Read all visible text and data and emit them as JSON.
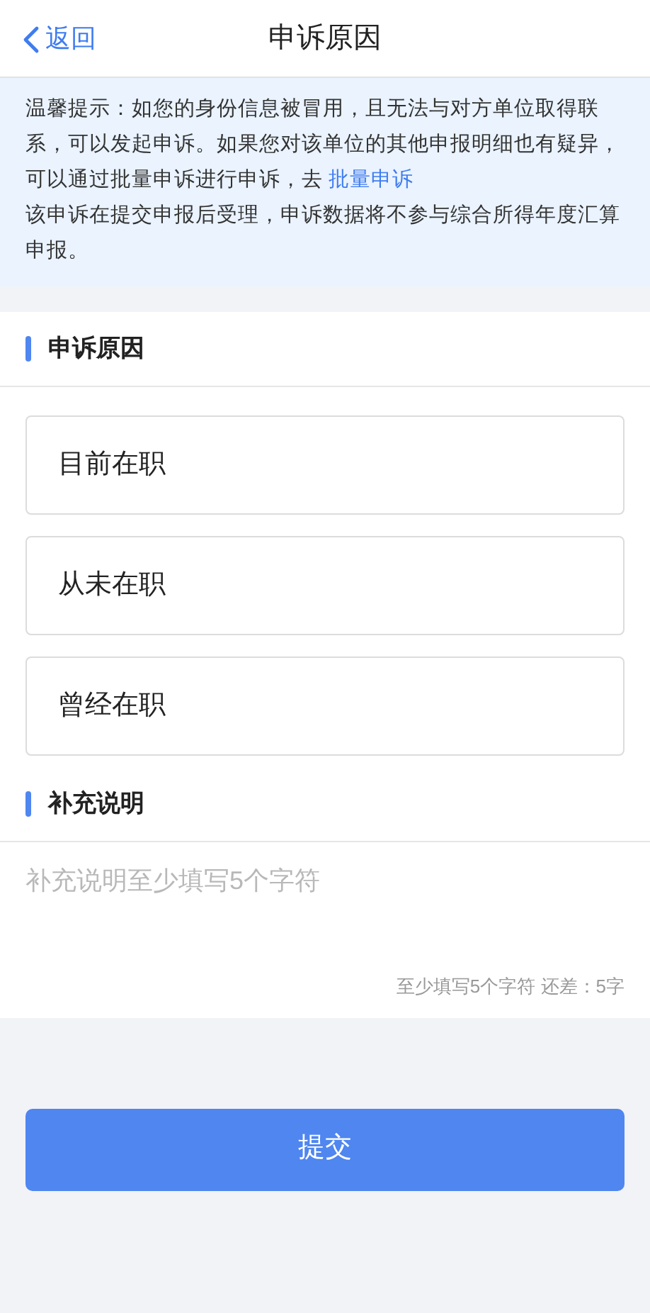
{
  "nav": {
    "back": "返回",
    "title": "申诉原因"
  },
  "notice": {
    "text": "温馨提示：如您的身份信息被冒用，且无法与对方单位取得联系，可以发起申诉。如果您对该单位的其他申报明细也有疑异，可以通过批量申诉进行申诉，去 ",
    "link": "批量申诉",
    "note": "该申诉在提交申报后受理，申诉数据将不参与综合所得年度汇算申报。"
  },
  "reason_section": {
    "title": "申诉原因",
    "options": [
      {
        "label": "目前在职",
        "selected": false
      },
      {
        "label": "从未在职",
        "selected": false
      },
      {
        "label": "曾经在职",
        "selected": false
      }
    ]
  },
  "remark_section": {
    "title": "补充说明",
    "placeholder": "补充说明至少填写5个字符",
    "counter": "至少填写5个字符 还差：5字"
  },
  "submit": "提交"
}
